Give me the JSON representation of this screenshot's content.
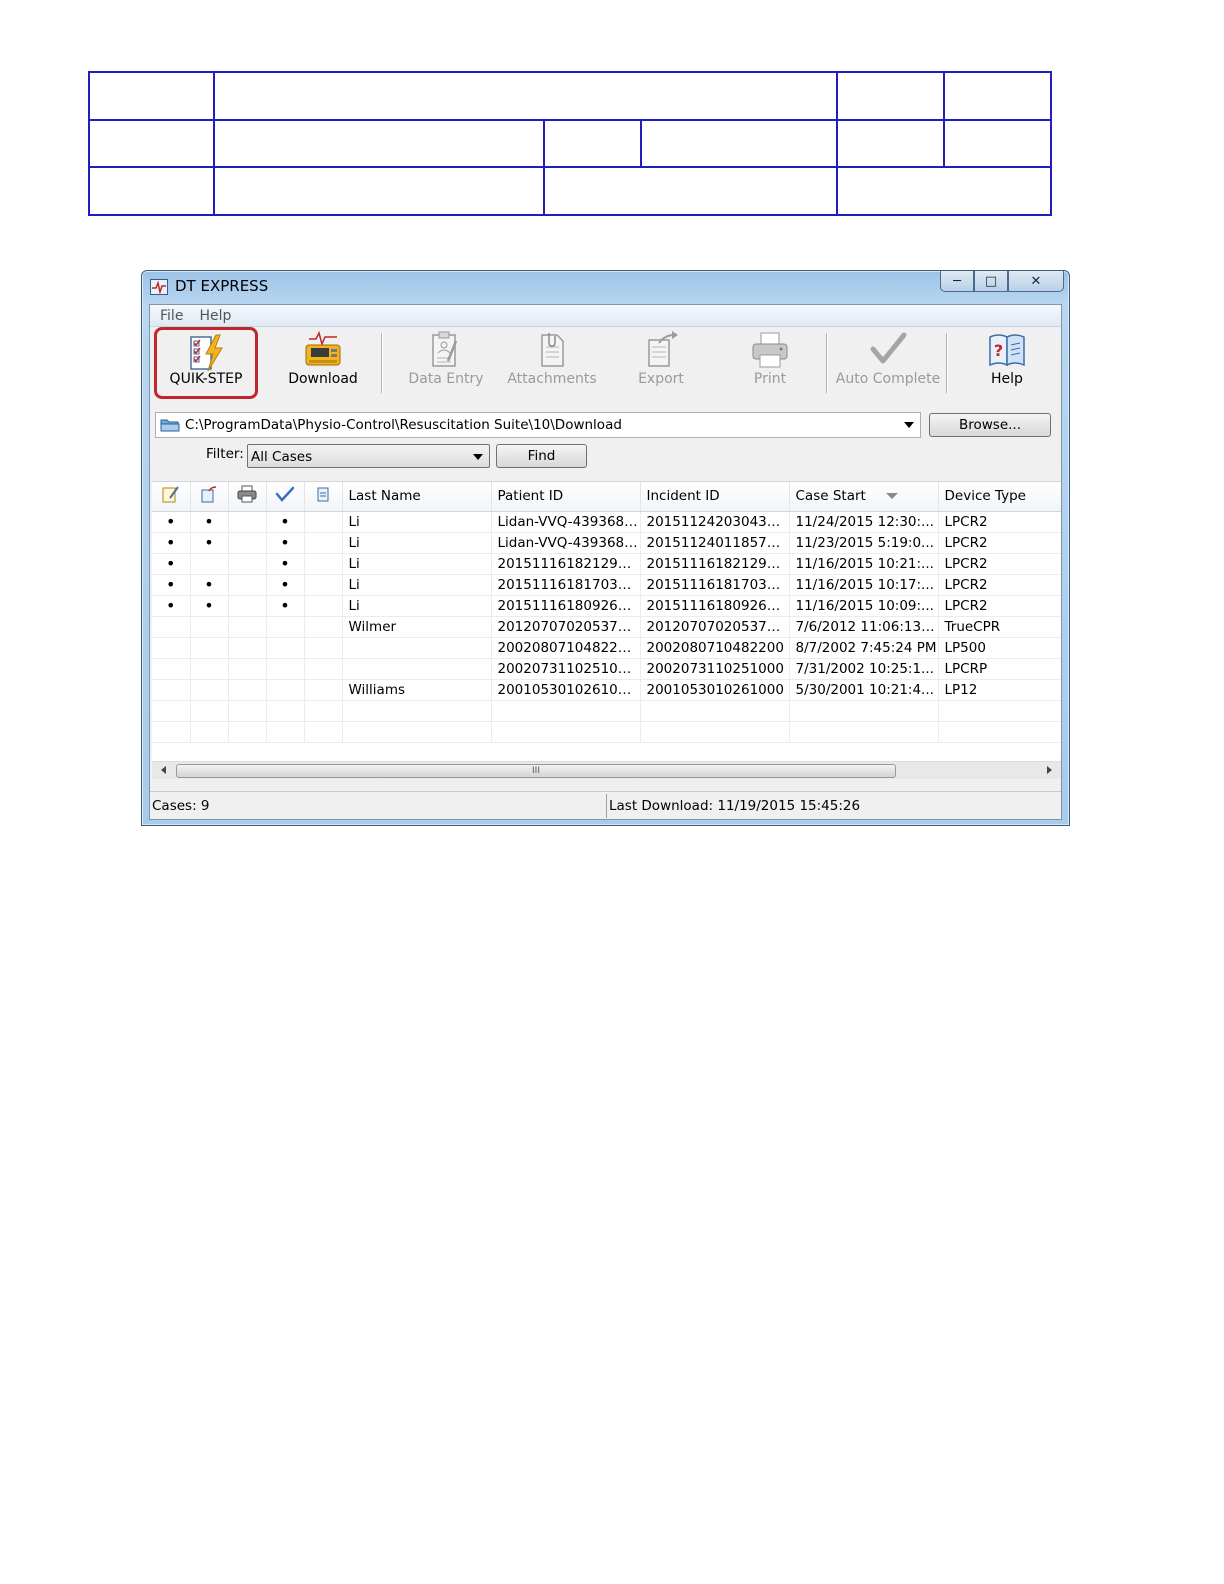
{
  "window": {
    "title": "DT EXPRESS"
  },
  "menu": [
    "File",
    "Help"
  ],
  "toolbar": {
    "quik_step": "QUIK-STEP",
    "download": "Download",
    "data_entry": "Data Entry",
    "attachments": "Attachments",
    "export": "Export",
    "print": "Print",
    "auto_complete": "Auto Complete",
    "help": "Help"
  },
  "path": {
    "value": "C:\\ProgramData\\Physio-Control\\Resuscitation Suite\\10\\Download",
    "browse_label": "Browse..."
  },
  "filter": {
    "label": "Filter:",
    "value": "All Cases",
    "find_label": "Find"
  },
  "grid": {
    "columns": [
      "Last Name",
      "Patient ID",
      "Incident ID",
      "Case Start",
      "Device Type"
    ],
    "rows": [
      {
        "marks": [
          "•",
          "•",
          "",
          "•",
          ""
        ],
        "last": "Li",
        "patient": "Lidan-VVQ-43936886",
        "incident": "2015112420304300...",
        "start": "11/24/2015 12:30:...",
        "device": "LPCR2"
      },
      {
        "marks": [
          "•",
          "•",
          "",
          "•",
          ""
        ],
        "last": "Li",
        "patient": "Lidan-VVQ-43936886",
        "incident": "2015112401185700...",
        "start": "11/23/2015 5:19:0...",
        "device": "LPCR2"
      },
      {
        "marks": [
          "•",
          "",
          "",
          "•",
          ""
        ],
        "last": "Li",
        "patient": "2015111618212900...",
        "incident": "2015111618212900...",
        "start": "11/16/2015 10:21:...",
        "device": "LPCR2"
      },
      {
        "marks": [
          "•",
          "•",
          "",
          "•",
          ""
        ],
        "last": "Li",
        "patient": "2015111618170300...",
        "incident": "2015111618170300...",
        "start": "11/16/2015 10:17:...",
        "device": "LPCR2"
      },
      {
        "marks": [
          "•",
          "•",
          "",
          "•",
          ""
        ],
        "last": "Li",
        "patient": "2015111618092600...",
        "incident": "2015111618092600...",
        "start": "11/16/2015 10:09:...",
        "device": "LPCR2"
      },
      {
        "marks": [
          "",
          "",
          "",
          "",
          ""
        ],
        "last": "Wilmer",
        "patient": "2012070702053700...",
        "incident": "2012070702053700...",
        "start": "7/6/2012 11:06:13 ...",
        "device": "TrueCPR"
      },
      {
        "marks": [
          "",
          "",
          "",
          "",
          ""
        ],
        "last": "",
        "patient": "2002080710482200...",
        "incident": "2002080710482200",
        "start": "8/7/2002 7:45:24 PM",
        "device": "LP500"
      },
      {
        "marks": [
          "",
          "",
          "",
          "",
          ""
        ],
        "last": "",
        "patient": "2002073110251000...",
        "incident": "2002073110251000",
        "start": "7/31/2002 10:25:1...",
        "device": "LPCRP"
      },
      {
        "marks": [
          "",
          "",
          "",
          "",
          ""
        ],
        "last": "Williams",
        "patient": "2001053010261000...",
        "incident": "2001053010261000",
        "start": "5/30/2001 10:21:4...",
        "device": "LP12"
      }
    ],
    "empty_rows": 2
  },
  "scrollbar": {
    "grip": "III"
  },
  "status": {
    "cases": "Cases: 9",
    "last_download": "Last Download: 11/19/2015 15:45:26"
  },
  "colors": {
    "highlight": "#c0262d",
    "table_border": "#1f1fbf"
  }
}
